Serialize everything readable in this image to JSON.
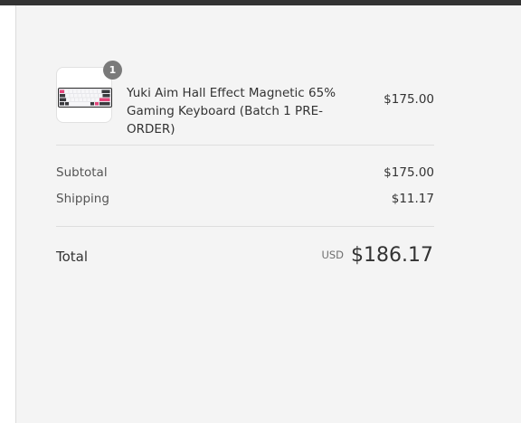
{
  "colors": {
    "panel_bg": "#f4f4f4",
    "badge_bg": "#7a7a7a",
    "text": "#333333",
    "divider": "#dedede"
  },
  "order": {
    "item": {
      "quantity": "1",
      "name": "Yuki Aim Hall Effect Magnetic 65% Gaming Keyboard (Batch 1 PRE-ORDER)",
      "price": "$175.00",
      "image_icon": "keyboard-product-image"
    },
    "subtotal_label": "Subtotal",
    "subtotal_value": "$175.00",
    "shipping_label": "Shipping",
    "shipping_value": "$11.17",
    "total_label": "Total",
    "currency": "USD",
    "total_value": "$186.17"
  }
}
